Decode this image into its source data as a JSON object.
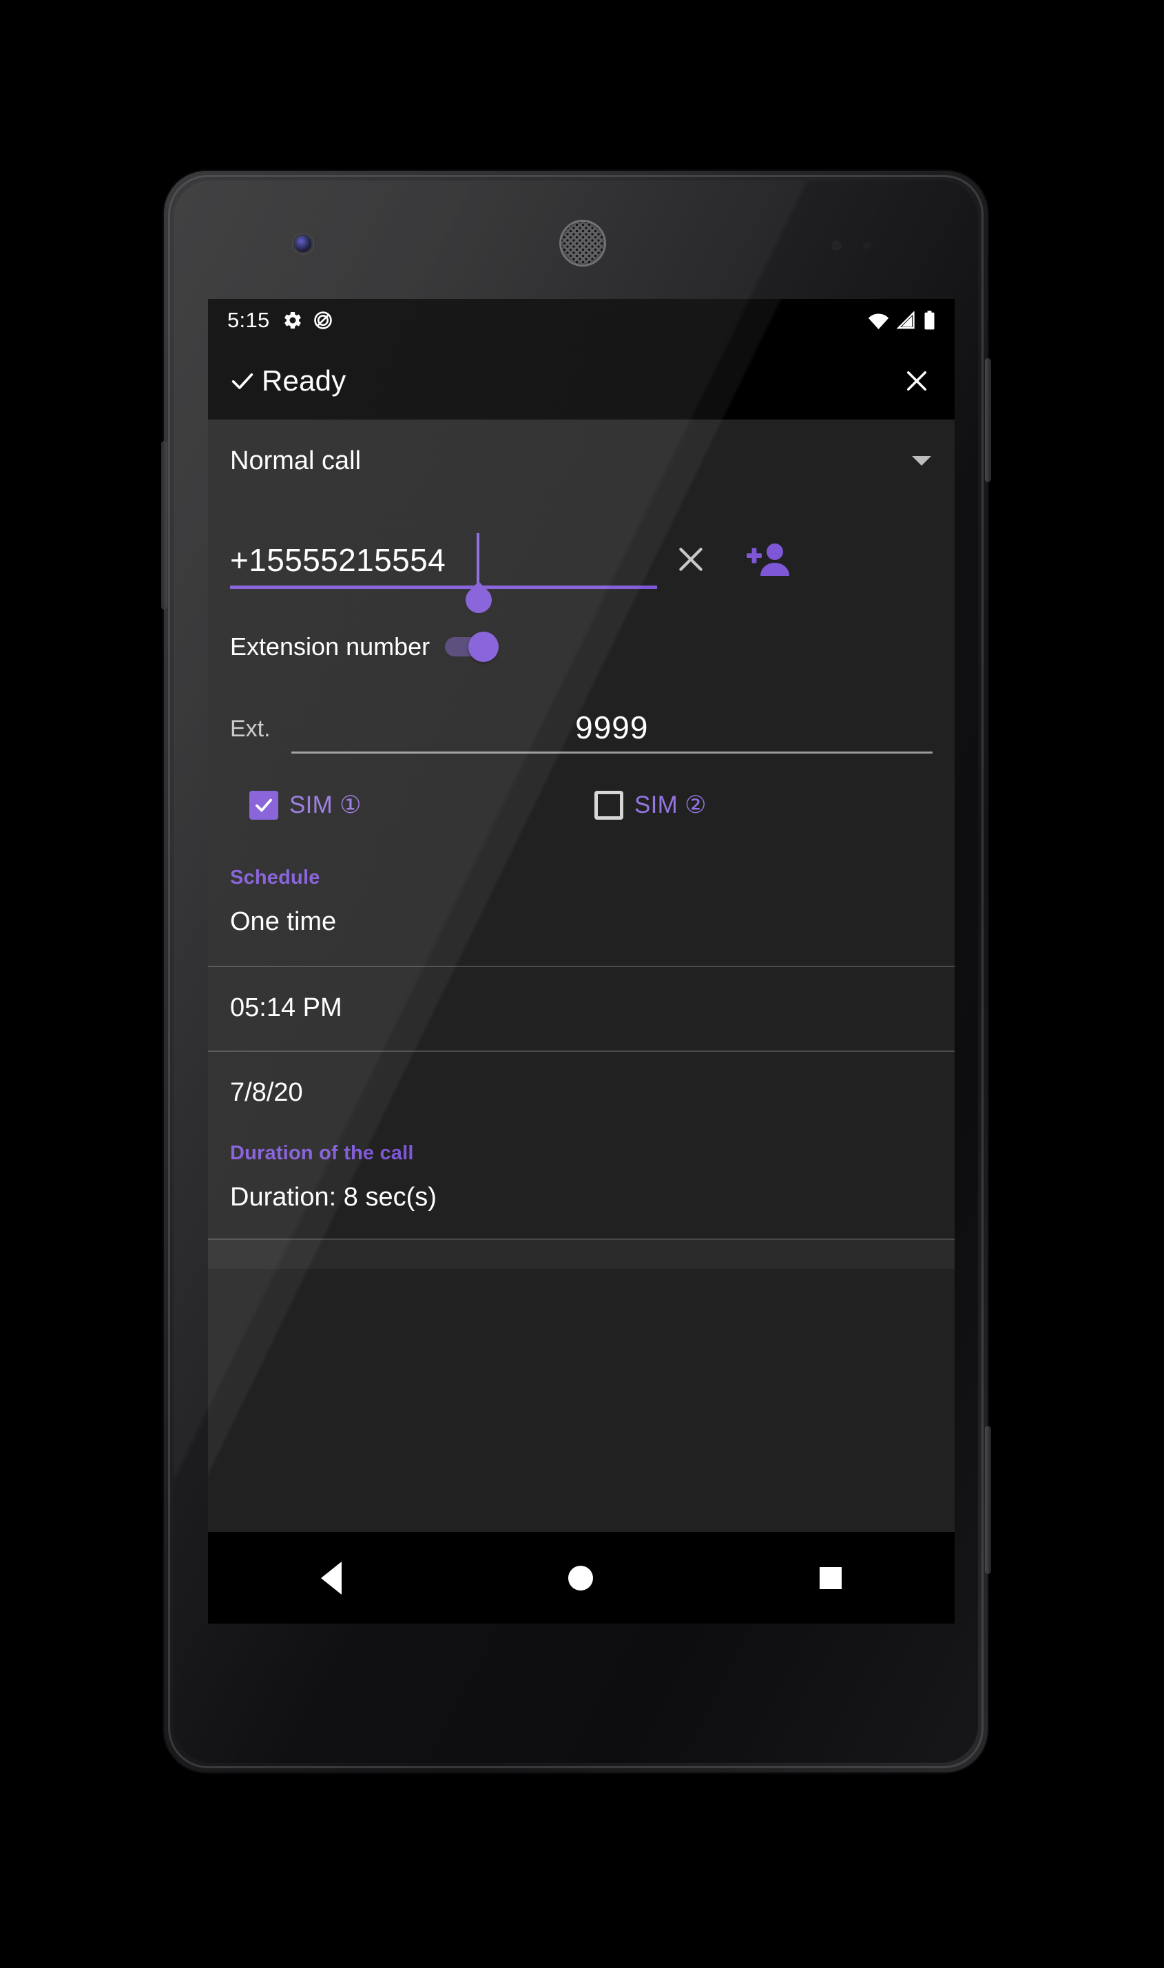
{
  "device": {
    "camera_icon": "front-camera-lens",
    "earpiece_icon": "earpiece-speaker",
    "proximity_sensor_icon": "proximity-sensor",
    "light_sensor_icon": "ambient-light-sensor"
  },
  "status_bar": {
    "time": "5:15",
    "left_icons": [
      "gear-icon",
      "do-not-disturb-icon"
    ],
    "right_icons": [
      "wifi-icon",
      "cell-signal-icon",
      "battery-icon"
    ]
  },
  "app_bar": {
    "check_icon": "check-icon",
    "title": "Ready",
    "close_icon": "close-icon"
  },
  "call_type": {
    "selected": "Normal call",
    "caret_icon": "chevron-down-icon"
  },
  "phone_number": {
    "value": "+15555215554",
    "clear_icon": "clear-x-icon",
    "add_contact_icon": "add-person-icon",
    "selection_handle_icon": "text-selection-handle"
  },
  "extension": {
    "toggle_label": "Extension number",
    "toggle_state": "on",
    "field_label": "Ext.",
    "field_value": "9999"
  },
  "sims": [
    {
      "label": "SIM ①",
      "checked": true
    },
    {
      "label": "SIM ②",
      "checked": false
    }
  ],
  "schedule": {
    "header": "Schedule",
    "repeat": "One time",
    "time": "05:14 PM",
    "date": "7/8/20"
  },
  "duration": {
    "header": "Duration of the call",
    "value": "Duration: 8 sec(s)"
  },
  "nav_bar": {
    "back_icon": "back-triangle-icon",
    "home_icon": "home-circle-icon",
    "recents_icon": "recents-square-icon"
  },
  "colors": {
    "accent_purple": "#7e57d6",
    "sim_label_purple": "#9575e0",
    "screen_background": "#212121",
    "bar_background": "#000000"
  }
}
